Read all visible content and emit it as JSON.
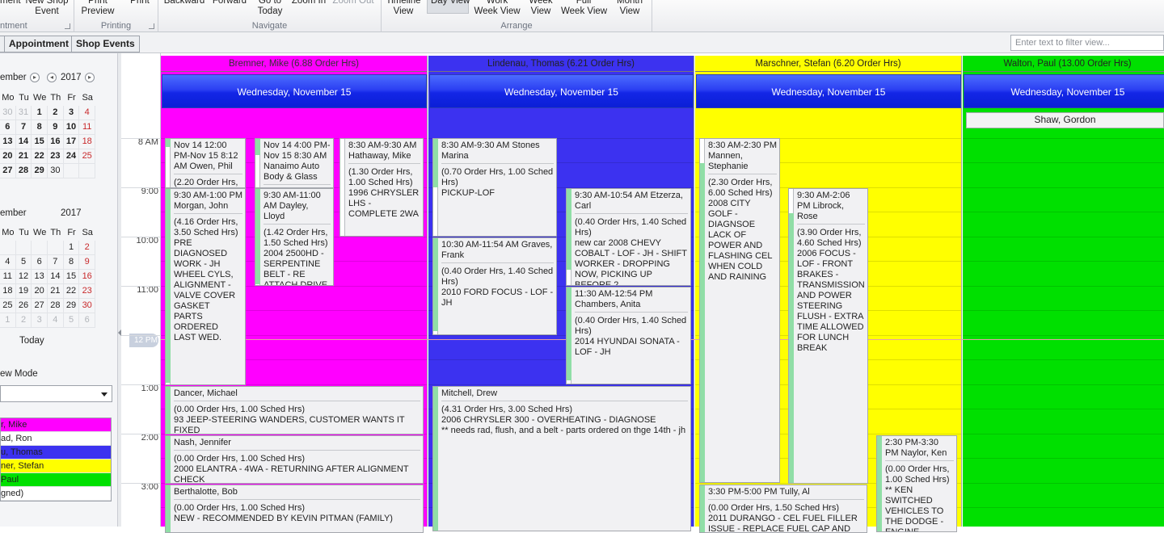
{
  "ribbon": {
    "groups": [
      {
        "label": "ntment",
        "buttons": [
          {
            "label": "ment"
          },
          {
            "label": "New Shop\nEvent"
          }
        ]
      },
      {
        "label": "Printing",
        "buttons": [
          {
            "label": "Print\nPreview"
          },
          {
            "label": "Print"
          }
        ]
      },
      {
        "label": "Navigate",
        "buttons": [
          {
            "label": "Backward"
          },
          {
            "label": "Forward"
          },
          {
            "label": "Go to\nToday"
          },
          {
            "label": "Zoom In"
          },
          {
            "label": "Zoom Out"
          }
        ]
      },
      {
        "label": "Arrange",
        "buttons": [
          {
            "label": "Timeline\nView"
          },
          {
            "label": "Day View"
          },
          {
            "label": "Work\nWeek View"
          },
          {
            "label": "Week\nView"
          },
          {
            "label": "Full\nWeek View"
          },
          {
            "label": "Month\nView"
          }
        ]
      }
    ]
  },
  "tabs": [
    "Appointment",
    "Shop Events"
  ],
  "filter_placeholder": "Enter text to filter view...",
  "navigator": {
    "month1": "ember",
    "month2": "ember",
    "year": "2017",
    "weekdays": [
      "Mo",
      "Tu",
      "We",
      "Th",
      "Fr",
      "Sa"
    ],
    "cal1": [
      [
        "30",
        "31",
        "1",
        "2",
        "3",
        "4"
      ],
      [
        "6",
        "7",
        "8",
        "9",
        "10",
        "11"
      ],
      [
        "13",
        "14",
        "15",
        "16",
        "17",
        "18"
      ],
      [
        "20",
        "21",
        "22",
        "23",
        "24",
        "25"
      ],
      [
        "27",
        "28",
        "29",
        "30",
        "",
        ""
      ]
    ],
    "cal2": [
      [
        "",
        "",
        "",
        "",
        "1",
        "2"
      ],
      [
        "4",
        "5",
        "6",
        "7",
        "8",
        "9"
      ],
      [
        "11",
        "12",
        "13",
        "14",
        "15",
        "16"
      ],
      [
        "18",
        "19",
        "20",
        "21",
        "22",
        "23"
      ],
      [
        "25",
        "26",
        "27",
        "28",
        "29",
        "30"
      ],
      [
        "1",
        "2",
        "3",
        "4",
        "5",
        "6"
      ]
    ],
    "today_label": "Today",
    "view_mode_label": "ew Mode",
    "resources": [
      {
        "label": "r, Mike",
        "color": "#ff00ff"
      },
      {
        "label": "ad, Ron",
        "color": "#ffffff"
      },
      {
        "label": "u, Thomas",
        "color": "#3c32f0"
      },
      {
        "label": "ner, Stefan",
        "color": "#ffff00"
      },
      {
        "label": "Paul",
        "color": "#00e000"
      },
      {
        "label": "gned)",
        "color": "#ffffff"
      }
    ]
  },
  "times": [
    "8 AM",
    "9:00",
    "10:00",
    "11:00",
    "12 PM",
    "1:00",
    "2:00",
    "3:00"
  ],
  "columns": [
    {
      "resource": "Bremner, Mike (6.88 Order Hrs)",
      "date": "Wednesday, November 15",
      "color": "#ff00ff",
      "text_color": "#333333"
    },
    {
      "resource": "Lindenau, Thomas (6.21 Order Hrs)",
      "date": "Wednesday, November 15",
      "color": "#3c32f0",
      "text_color": "#222222"
    },
    {
      "resource": "Marschner, Stefan (6.20 Order Hrs)",
      "date": "Wednesday, November 15",
      "color": "#ffff00",
      "text_color": "#222222"
    },
    {
      "resource": "Walton, Paul (13.00 Order Hrs)",
      "date": "Wednesday, November 15",
      "color": "#00e000",
      "text_color": "#222222"
    }
  ],
  "allday": [
    {
      "col": 3,
      "label": "Shaw, Gordon"
    }
  ],
  "appointments": [
    {
      "col": 0,
      "title": "Nov 14 12:00 PM-Nov 15 8:12 AM Owen, Phil",
      "desc": "(2.20 Order Hrs,"
    },
    {
      "col": 0,
      "title": "Nov 14 4:00 PM-Nov 15 8:30 AM Nanaimo Auto Body & Glass",
      "desc": ""
    },
    {
      "col": 0,
      "title": "8:30 AM-9:30 AM Hathaway, Mike",
      "desc": "(1.30 Order Hrs, 1.00 Sched Hrs)\n1996 CHRYSLER LHS - COMPLETE 2WA"
    },
    {
      "col": 0,
      "title": "9:30 AM-1:00 PM Morgan, John",
      "desc": "(4.16 Order Hrs, 3.50 Sched Hrs)\nPRE DIAGNOSED WORK - JH WHEEL CYLS, ALIGNMENT - VALVE COVER GASKET\nPARTS ORDERED LAST WED."
    },
    {
      "col": 0,
      "title": "9:30 AM-11:00 AM Dayley, Lloyd",
      "desc": "(1.42 Order Hrs, 1.50 Sched Hrs)\n2004 2500HD - SERPENTINE BELT - RE ATTACH DRIVE"
    },
    {
      "col": 0,
      "title": "Dancer, Michael",
      "desc": "(0.00 Order Hrs, 1.00 Sched Hrs)\n93 JEEP-STEERING WANDERS, CUSTOMER WANTS IT FIXED"
    },
    {
      "col": 0,
      "title": "Nash, Jennifer",
      "desc": "(0.00 Order Hrs, 1.00 Sched Hrs)\n2000 ELANTRA - 4WA - RETURNING AFTER ALIGNMENT CHECK"
    },
    {
      "col": 0,
      "title": "Berthalotte, Bob",
      "desc": "(0.00 Order Hrs, 1.00 Sched Hrs)\nNEW - RECOMMENDED BY KEVIN PITMAN (FAMILY)"
    },
    {
      "col": 1,
      "title": "8:30 AM-9:30 AM Stones Marina",
      "desc": "(0.70 Order Hrs, 1.00 Sched Hrs)\nPICKUP-LOF"
    },
    {
      "col": 1,
      "title": "9:30 AM-10:54 AM Etzerza, Carl",
      "desc": "(0.40 Order Hrs, 1.40 Sched Hrs)\nnew car 2008 CHEVY COBALT - LOF - JH - SHIFT WORKER - DROPPING NOW, PICKING UP BEFORE 2"
    },
    {
      "col": 1,
      "title": "10:30 AM-11:54 AM Graves, Frank",
      "desc": "(0.40 Order Hrs, 1.40 Sched Hrs)\n2010 FORD FOCUS - LOF - JH"
    },
    {
      "col": 1,
      "title": "11:30 AM-12:54 PM Chambers, Anita",
      "desc": "(0.40 Order Hrs, 1.40 Sched Hrs)\n2014 HYUNDAI SONATA - LOF - JH"
    },
    {
      "col": 1,
      "title": "Mitchell, Drew",
      "desc": "(4.31 Order Hrs, 3.00 Sched Hrs)\n2006 CHRYSLER 300 - OVERHEATING - DIAGNOSE\n** needs rad, flush, and a belt - parts ordered on thge 14th - jh"
    },
    {
      "col": 2,
      "title": "8:30 AM-2:30 PM Mannen, Stephanie",
      "desc": "(2.30 Order Hrs, 6.00 Sched Hrs)\n2008 CITY GOLF - DIAGNSOE LACK OF POWER AND FLASHING CEL WHEN COLD AND RAINING"
    },
    {
      "col": 2,
      "title": "9:30 AM-2:06 PM Librock, Rose",
      "desc": "(3.90 Order Hrs, 4.60 Sched Hrs)\n2006 FOCUS - LOF - FRONT BRAKES - TRANSMISSION AND POWER STEERING FLUSH - EXTRA TIME ALLOWED FOR LUNCH BREAK"
    },
    {
      "col": 2,
      "title": "2:30 PM-3:30 PM Naylor, Ken",
      "desc": "(0.00 Order Hrs, 1.00 Sched Hrs)\n** KEN SWITCHED VEHICLES TO THE DODGE - ENGINE"
    },
    {
      "col": 2,
      "title": "3:30 PM-5:00 PM Tully, Al",
      "desc": "(0.00 Order Hrs, 1.50 Sched Hrs)\n2011 DURANGO - CEL FUEL FILLER ISSUE - REPLACE FUEL CAP AND"
    }
  ]
}
